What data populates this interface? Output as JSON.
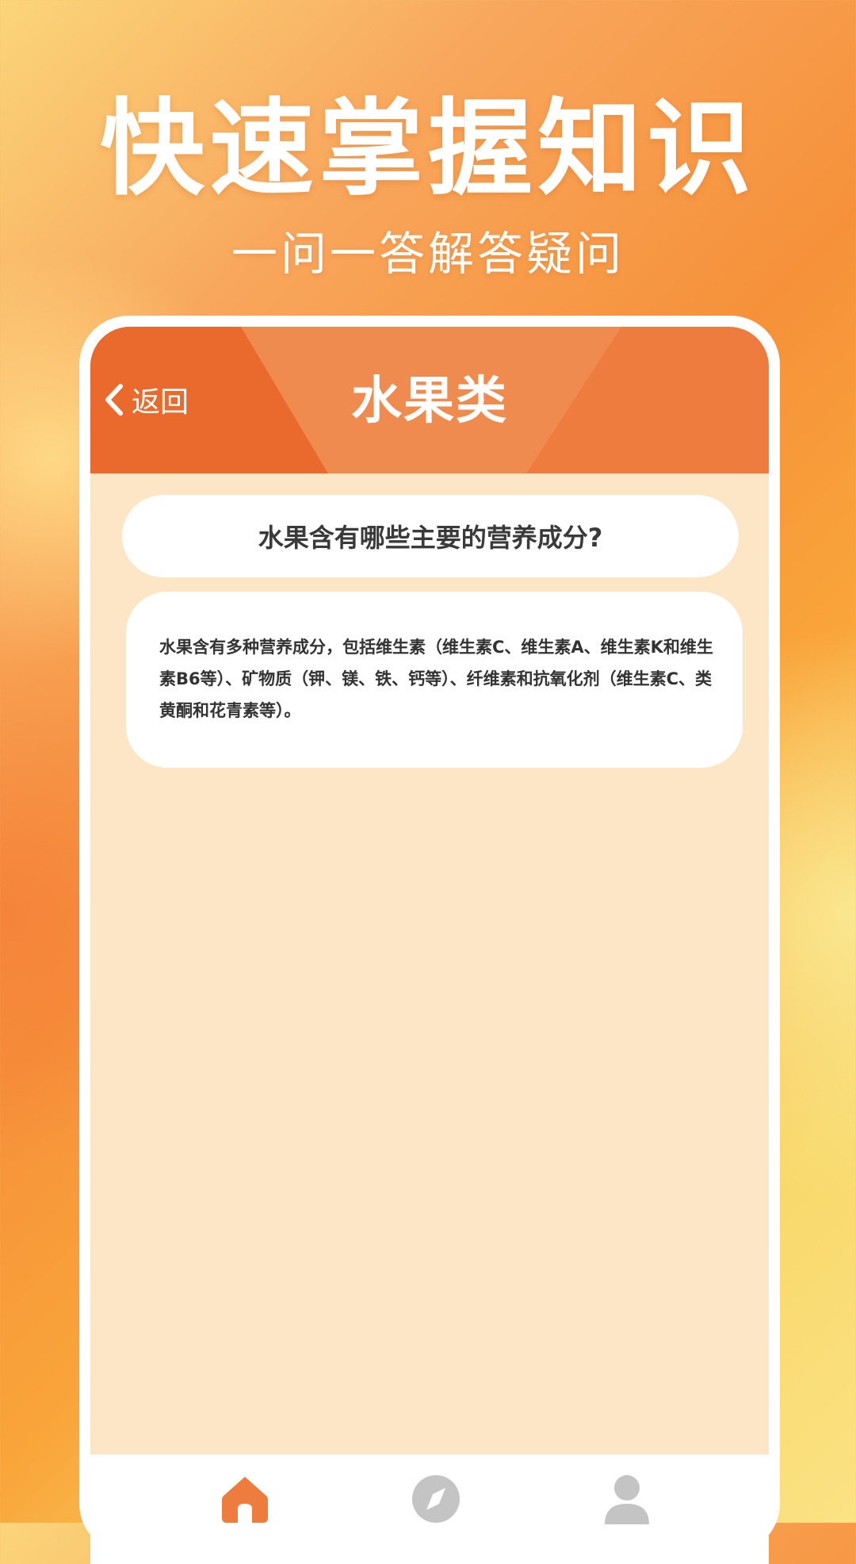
{
  "promo": {
    "title": "快速掌握知识",
    "subtitle": "一问一答解答疑问"
  },
  "header": {
    "back_label": "返回",
    "title": "水果类"
  },
  "qa": {
    "question": "水果含有哪些主要的营养成分?",
    "answer": "水果含有多种营养成分，包括维生素（维生素C、维生素A、维生素K和维生素B6等）、矿物质（钾、镁、铁、钙等）、纤维素和抗氧化剂（维生素C、类黄酮和花青素等）。"
  },
  "tabbar": {
    "items": [
      {
        "icon": "home-icon",
        "active": true
      },
      {
        "icon": "compass-icon",
        "active": false
      },
      {
        "icon": "profile-icon",
        "active": false
      }
    ]
  },
  "colors": {
    "accent": "#ee7c3f",
    "active_tab": "#ee7c3f",
    "inactive_tab": "#c4c4c4",
    "card_background": "#fde6c5"
  }
}
